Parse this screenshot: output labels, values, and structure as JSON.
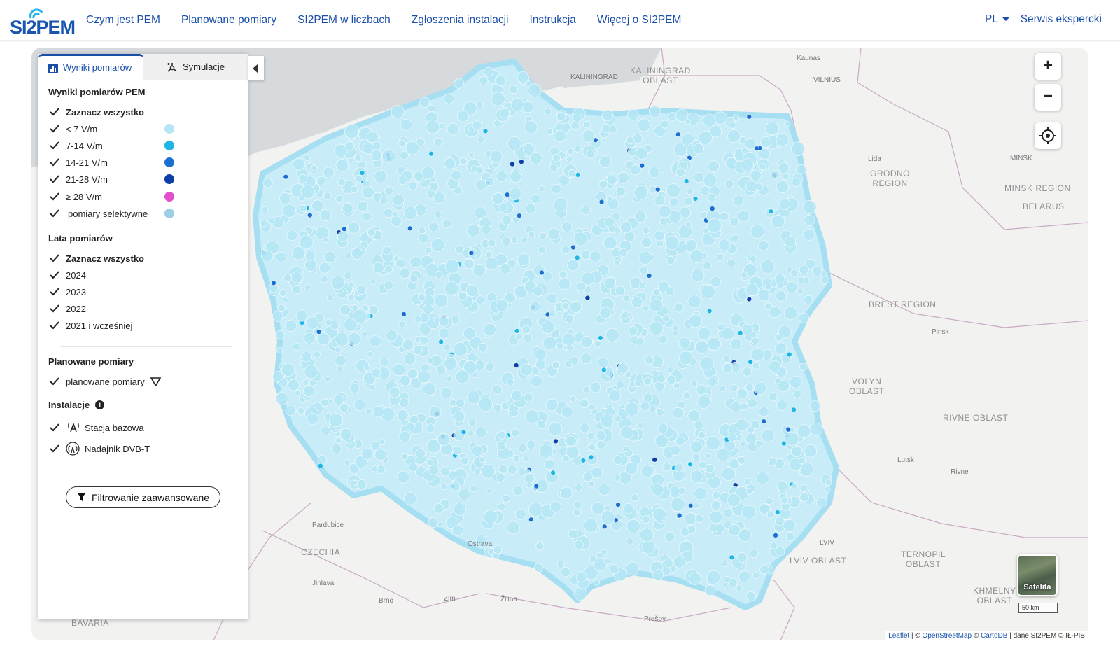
{
  "app": {
    "logo_text": "SI2PEM"
  },
  "nav": {
    "items": [
      "Czym jest PEM",
      "Planowane pomiary",
      "SI2PEM w liczbach",
      "Zgłoszenia instalacji",
      "Instrukcja",
      "Więcej o SI2PEM"
    ],
    "lang": "PL",
    "expert": "Serwis ekspercki"
  },
  "panel": {
    "tabs": {
      "results": "Wyniki pomiarów",
      "simulations": "Symulacje"
    },
    "results_title": "Wyniki pomiarów PEM",
    "select_all": "Zaznacz wszystko",
    "ranges": [
      {
        "label": "< 7 V/m",
        "color": "#b5e6f5"
      },
      {
        "label": "7-14 V/m",
        "color": "#1fb6e6"
      },
      {
        "label": "14-21 V/m",
        "color": "#1a6fd0"
      },
      {
        "label": "21-28 V/m",
        "color": "#0d3fa8"
      },
      {
        "label": "≥ 28 V/m",
        "color": "#e24ecb"
      },
      {
        "label": "pomiary selektywne",
        "color": "#9ccfe6"
      }
    ],
    "years_title": "Lata pomiarów",
    "years_select_all": "Zaznacz wszystko",
    "years": [
      "2024",
      "2023",
      "2022",
      "2021 i wcześniej"
    ],
    "planned_title": "Planowane pomiary",
    "planned_label": "planowane pomiary",
    "install_title": "Instalacje",
    "install_items": [
      "Stacja bazowa",
      "Nadajnik DVB-T"
    ],
    "filter_button": "Filtrowanie zaawansowane"
  },
  "map": {
    "zoom_in": "+",
    "zoom_out": "−",
    "satellite_label": "Satelita",
    "scale_label": "50 km",
    "attribution": {
      "leaflet": "Leaflet",
      "sep1": " | © ",
      "osm": "OpenStreetMap",
      "sep2": " © ",
      "carto": "CartoDB",
      "rest": " | dane SI2PEM © IŁ-PIB"
    },
    "regions": [
      "KALININGRAD\nOBLAST",
      "GRODNO\nREGION",
      "MINSK REGION",
      "BELARUS",
      "BREST REGION",
      "VOLYN\nOBLAST",
      "RIVNE OBLAST",
      "LVIV OBLAST",
      "TERNOPIL\nOBLAST",
      "KHMELNY\nOBLAST",
      "CZECHIA",
      "BAVARIA"
    ],
    "cities": [
      "Kaunas",
      "VILNIUS",
      "KALININGRAD",
      "Lida",
      "MINSK",
      "Pinsk",
      "Lutsk",
      "Rivne",
      "LVIV",
      "Pardubice",
      "Ostrava",
      "Brno",
      "Zlín",
      "Žilina",
      "Jihlava",
      "Prešov"
    ]
  }
}
